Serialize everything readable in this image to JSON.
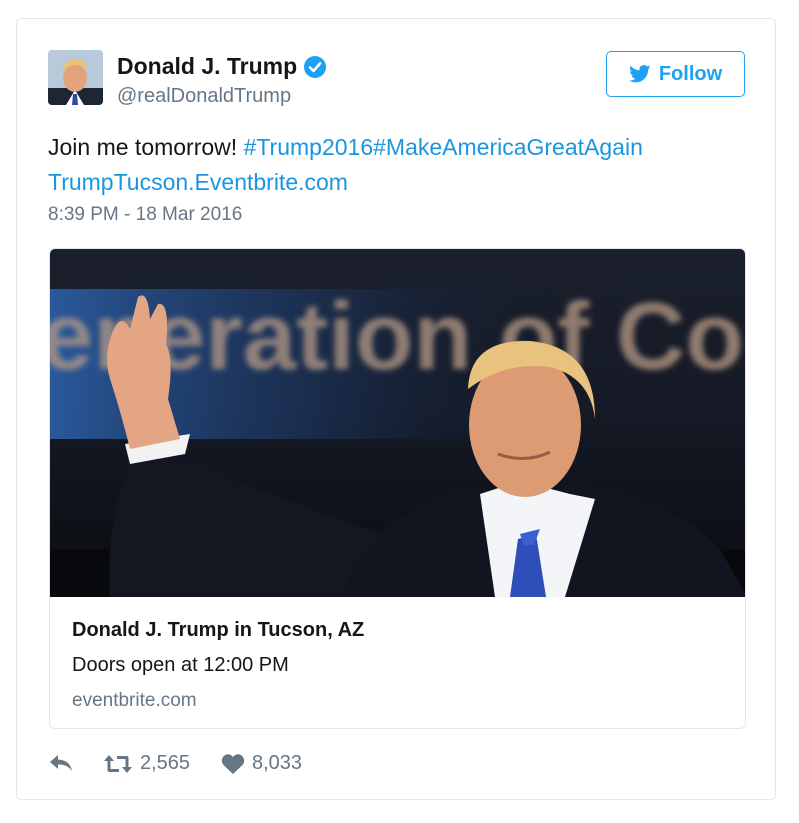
{
  "user": {
    "name": "Donald J. Trump",
    "handle": "@realDonaldTrump",
    "verified": true
  },
  "follow_button": {
    "label": "Follow",
    "icon": "twitter-bird-icon"
  },
  "tweet": {
    "text": "Join me tomorrow! ",
    "hashtag1": "#Trump2016",
    "hashtag2": "#MakeAmericaGreatAgain",
    "link": "TrumpTucson.Eventbrite.com",
    "timestamp": "8:39 PM - 18 Mar 2016"
  },
  "card": {
    "image_backdrop_text": "eneration of Conse",
    "title": "Donald J. Trump in Tucson, AZ",
    "description": "Doors open at 12:00 PM",
    "domain": "eventbrite.com"
  },
  "actions": {
    "reply_icon": "reply-icon",
    "retweet_icon": "retweet-icon",
    "retweets": "2,565",
    "like_icon": "heart-icon",
    "likes": "8,033"
  },
  "colors": {
    "accent": "#1da1f2",
    "link": "#1b95e0",
    "muted": "#657786",
    "border": "#e1e8ed"
  }
}
